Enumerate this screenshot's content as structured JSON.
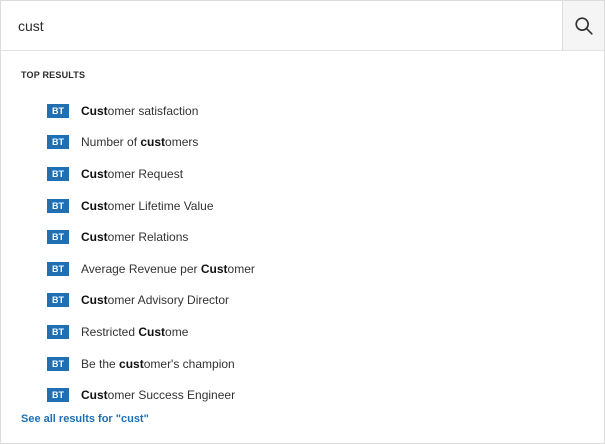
{
  "search": {
    "value": "cust",
    "placeholder": "",
    "button_icon": "search-icon"
  },
  "top_results": {
    "heading": "TOP RESULTS",
    "badge_color": "#1f6fb2",
    "items": [
      {
        "badge": "BT",
        "before": "",
        "match": "Cust",
        "after": "omer satisfaction"
      },
      {
        "badge": "BT",
        "before": "Number of ",
        "match": "cust",
        "after": "omers"
      },
      {
        "badge": "BT",
        "before": "",
        "match": "Cust",
        "after": "omer Request"
      },
      {
        "badge": "BT",
        "before": "",
        "match": "Cust",
        "after": "omer Lifetime Value"
      },
      {
        "badge": "BT",
        "before": "",
        "match": "Cust",
        "after": "omer Relations"
      },
      {
        "badge": "BT",
        "before": "Average Revenue per ",
        "match": "Cust",
        "after": "omer"
      },
      {
        "badge": "BT",
        "before": "",
        "match": "Cust",
        "after": "omer Advisory Director"
      },
      {
        "badge": "BT",
        "before": "Restricted ",
        "match": "Cust",
        "after": "ome"
      },
      {
        "badge": "BT",
        "before": "Be the ",
        "match": "cust",
        "after": "omer's champion"
      },
      {
        "badge": "BT",
        "before": "",
        "match": "Cust",
        "after": "omer Success Engineer"
      }
    ]
  },
  "see_all": {
    "label": "See all results for \"cust\""
  }
}
